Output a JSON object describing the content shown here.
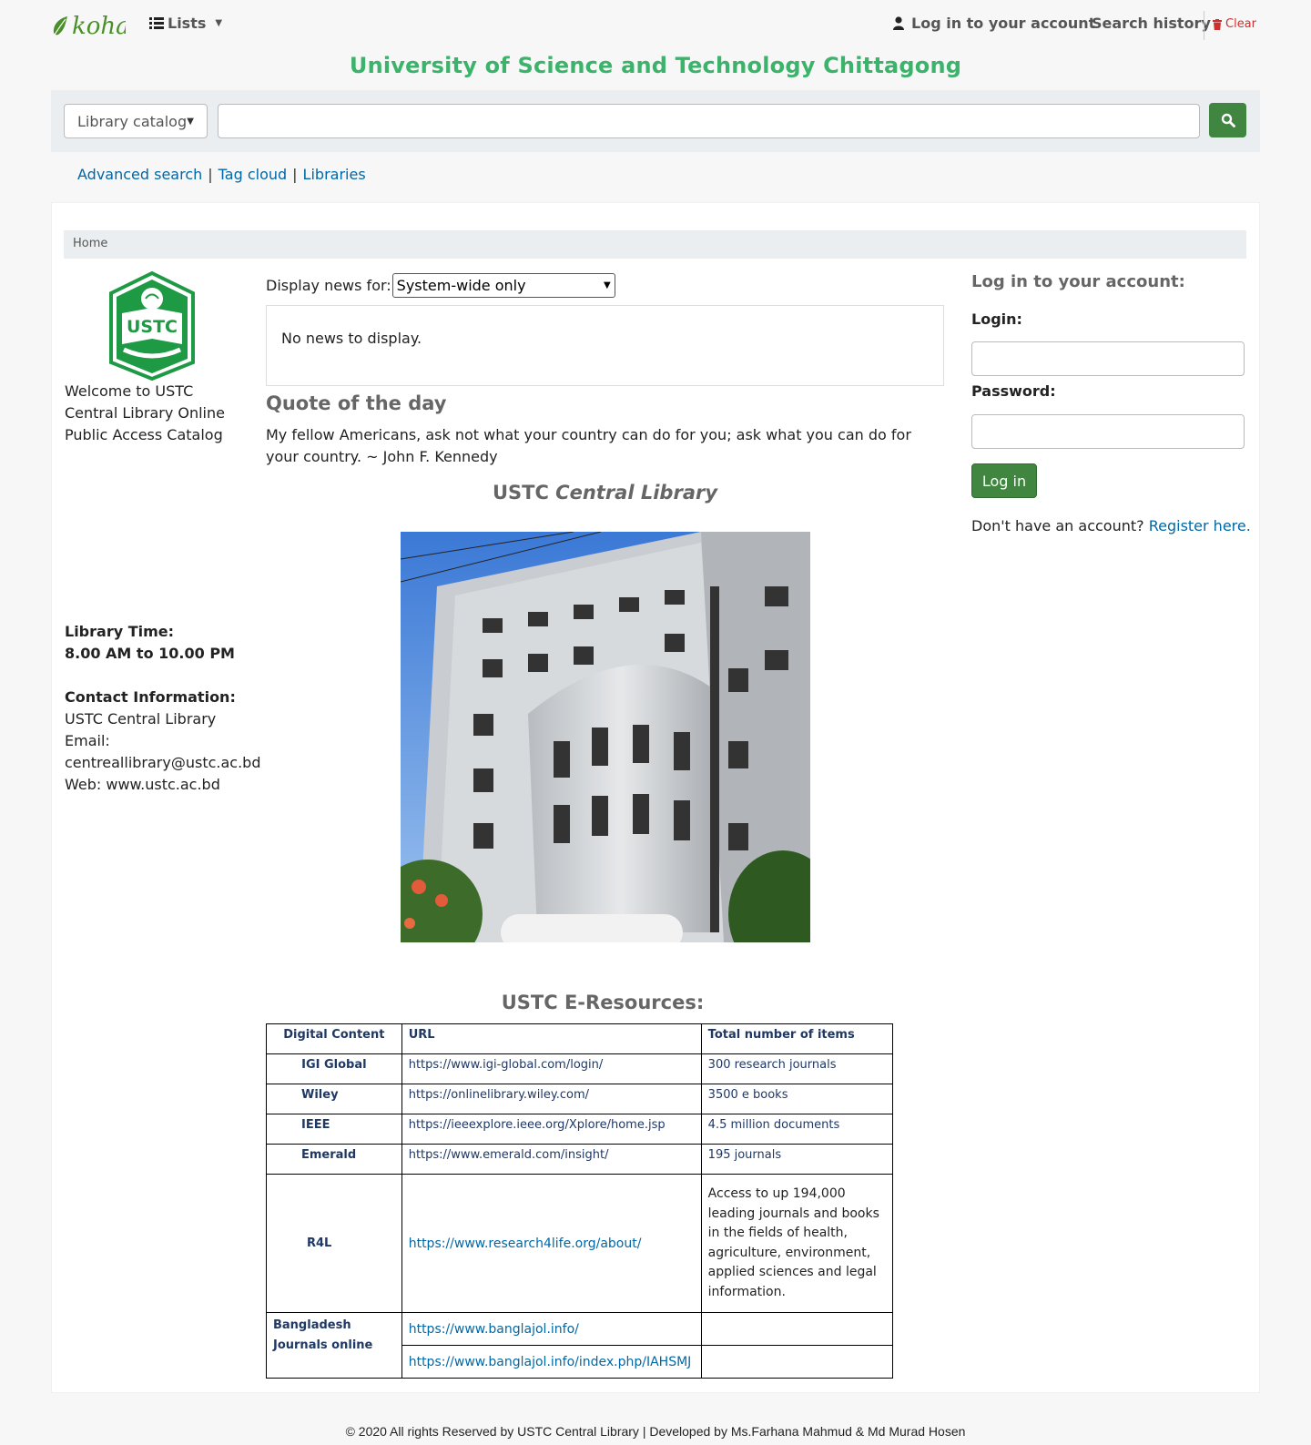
{
  "header": {
    "logo_text": "koha",
    "lists_label": "Lists",
    "login_label": "Log in to your account",
    "search_history_label": "Search history",
    "clear_label": "Clear"
  },
  "site_title": "University of Science and Technology Chittagong",
  "search": {
    "catalog_selected": "Library catalog",
    "query_value": ""
  },
  "more_searches": {
    "advanced": "Advanced search",
    "tag_cloud": "Tag cloud",
    "libraries": "Libraries",
    "separator": "|"
  },
  "breadcrumb": {
    "home": "Home"
  },
  "left": {
    "logo_text": "USTC",
    "welcome": "Welcome to USTC Central Library Online Public Access Catalog",
    "library_time_label": "Library Time:",
    "library_time_value": "8.00 AM to 10.00 PM",
    "contact_label": "Contact Information:",
    "contact_name": "USTC Central Library",
    "email_label": "Email:",
    "email_value": "centreallibrary@ustc.ac.bd",
    "web": "Web: www.ustc.ac.bd"
  },
  "news": {
    "display_label": "Display news for:",
    "selected": "System-wide only",
    "empty_text": "No news to display."
  },
  "quote": {
    "heading": "Quote of the day",
    "text": "My fellow Americans, ask not what your country can do for you; ask what you can do for your country. ~ John F. Kennedy"
  },
  "central": {
    "prefix": "USTC",
    "italic": "Central Library"
  },
  "eresources": {
    "heading": "USTC E-Resources:",
    "headers": [
      "Digital Content",
      "URL",
      "Total number of items"
    ],
    "rows": [
      {
        "name": "IGI Global",
        "url": "https://www.igi-global.com/login/",
        "items": "300 research journals"
      },
      {
        "name": "Wiley",
        "url": "https://onlinelibrary.wiley.com/",
        "items": "3500 e books"
      },
      {
        "name": "IEEE",
        "url": "https://ieeexplore.ieee.org/Xplore/home.jsp",
        "items": "4.5 million documents"
      },
      {
        "name": "Emerald",
        "url": "https://www.emerald.com/insight/",
        "items": "195 journals"
      },
      {
        "name": "R4L",
        "url": "https://www.research4life.org/about/",
        "items": "Access to up 194,000 leading journals and books in the fields of health, agriculture, environment, applied sciences and legal information."
      },
      {
        "name": "Bangladesh Journals online",
        "url": "https://www.banglajol.info/",
        "url2": "https://www.banglajol.info/index.php/IAHSMJ",
        "items": ""
      }
    ]
  },
  "login_panel": {
    "heading": "Log in to your account:",
    "login_label": "Login:",
    "password_label": "Password:",
    "button": "Log in",
    "no_account": "Don't have an account?",
    "register": "Register here."
  },
  "footer": "© 2020 All rights Reserved by USTC Central Library | Developed by  Ms.Farhana Mahmud & Md Murad Hosen",
  "colors": {
    "title_green": "#3bb36a",
    "button_green": "#408540",
    "link_blue": "#0068a6",
    "table_text": "#1f3864"
  }
}
